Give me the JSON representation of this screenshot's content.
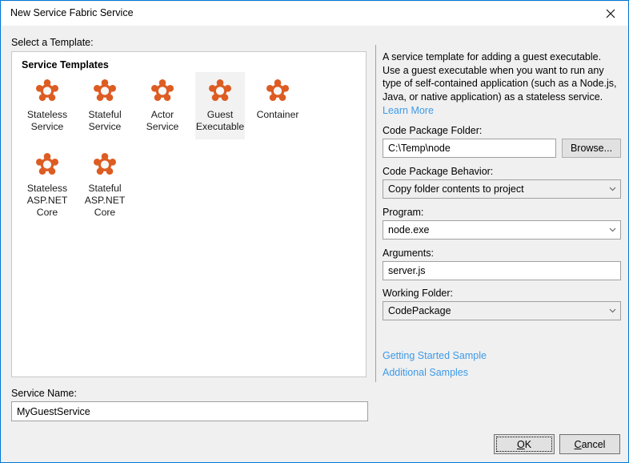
{
  "window": {
    "title": "New Service Fabric Service",
    "close_icon": "close-icon"
  },
  "left": {
    "select_template_label": "Select a Template:",
    "templates_group_title": "Service Templates",
    "templates": [
      {
        "label": "Stateless\nService",
        "icon": "service-fabric-icon",
        "selected": false
      },
      {
        "label": "Stateful\nService",
        "icon": "service-fabric-icon",
        "selected": false
      },
      {
        "label": "Actor Service",
        "icon": "service-fabric-icon",
        "selected": false
      },
      {
        "label": "Guest\nExecutable",
        "icon": "service-fabric-icon",
        "selected": true
      },
      {
        "label": "Container",
        "icon": "service-fabric-icon",
        "selected": false
      },
      {
        "label": "Stateless\nASP.NET\nCore",
        "icon": "service-fabric-icon",
        "selected": false
      },
      {
        "label": "Stateful\nASP.NET\nCore",
        "icon": "service-fabric-icon",
        "selected": false
      }
    ],
    "service_name_label": "Service Name:",
    "service_name_value": "MyGuestService"
  },
  "detail": {
    "description": "A service template for adding a guest executable. Use a guest executable when you want to run any type of self-contained application (such as a Node.js, Java, or native application) as a stateless service.",
    "learn_more_link": "Learn More",
    "code_package_folder_label": "Code Package Folder:",
    "code_package_folder_value": "C:\\Temp\\node",
    "browse_button": "Browse...",
    "code_package_behavior_label": "Code Package Behavior:",
    "code_package_behavior_value": "Copy folder contents to project",
    "program_label": "Program:",
    "program_value": "node.exe",
    "arguments_label": "Arguments:",
    "arguments_value": "server.js",
    "working_folder_label": "Working Folder:",
    "working_folder_value": "CodePackage",
    "getting_started_link": "Getting Started Sample",
    "additional_samples_link": "Additional Samples"
  },
  "buttons": {
    "ok_accel": "O",
    "ok_rest": "K",
    "cancel_accel": "C",
    "cancel_rest": "ancel"
  },
  "colors": {
    "accent_border": "#0078d7",
    "link": "#3d9ae8",
    "icon_orange": "#dd5c22",
    "dialog_bg": "#f0f0f0",
    "selection_bg": "#f2f2f2"
  }
}
